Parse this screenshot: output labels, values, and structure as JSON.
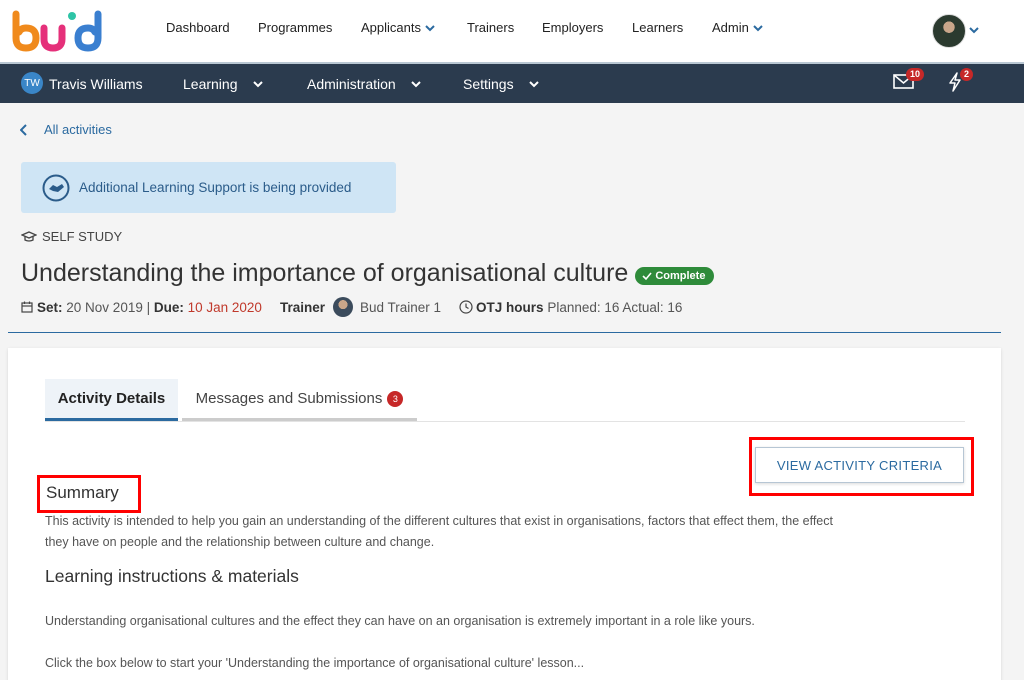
{
  "app": {
    "logo_text": "bud"
  },
  "topnav": {
    "items": [
      {
        "label": "Dashboard",
        "dropdown": false
      },
      {
        "label": "Programmes",
        "dropdown": false
      },
      {
        "label": "Applicants",
        "dropdown": true
      },
      {
        "label": "Trainers",
        "dropdown": false
      },
      {
        "label": "Employers",
        "dropdown": false
      },
      {
        "label": "Learners",
        "dropdown": false
      },
      {
        "label": "Admin",
        "dropdown": true
      }
    ]
  },
  "subnav": {
    "user_initials": "TW",
    "user_name": "Travis Williams",
    "items": [
      {
        "label": "Learning"
      },
      {
        "label": "Administration"
      },
      {
        "label": "Settings"
      }
    ],
    "mail_count": "10",
    "alerts_count": "2"
  },
  "page": {
    "back_label": "All activities",
    "support_message": "Additional Learning Support is being provided",
    "activity_type": "SELF STUDY",
    "title": "Understanding the importance of organisational culture",
    "status": "Complete",
    "set_label": "Set:",
    "set_date": "20 Nov 2019",
    "due_label": "Due:",
    "due_date": "10 Jan 2020",
    "trainer_label": "Trainer",
    "trainer_name": "Bud Trainer 1",
    "otj_label": "OTJ hours",
    "otj_value": "Planned: 16 Actual: 16"
  },
  "tabs": [
    {
      "label": "Activity Details",
      "active": true
    },
    {
      "label": "Messages and Submissions",
      "badge": "3"
    }
  ],
  "content": {
    "criteria_button": "VIEW ACTIVITY CRITERIA",
    "summary_heading": "Summary",
    "summary_line1": "This activity is intended to help you gain an understanding of the different cultures that exist in organisations, factors that effect them, the effect",
    "summary_line2": "they have on people and the relationship between culture and change.",
    "instructions_heading": "Learning instructions & materials",
    "paragraph1": "Understanding organisational cultures and the effect they can have on an organisation is extremely important in a role like yours.",
    "paragraph2": "Click the box below to start your 'Understanding the importance of organisational culture' lesson..."
  },
  "colors": {
    "brand_blue": "#2b6aa0",
    "navbar_dark": "#2b3b4e",
    "complete_green": "#2e8b3a",
    "badge_red": "#c62828",
    "highlight_red": "#ff0000"
  }
}
